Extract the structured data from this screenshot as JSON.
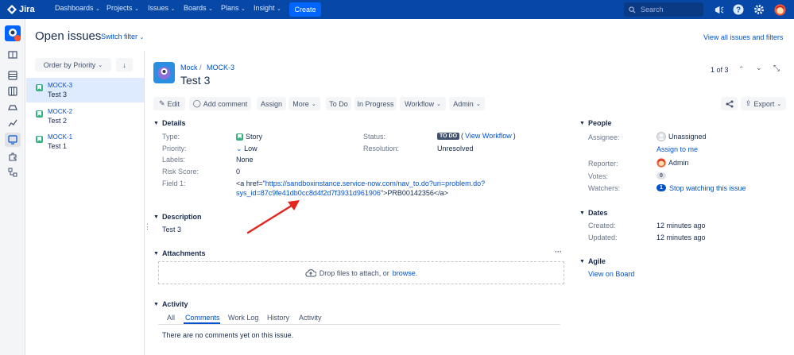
{
  "topnav": {
    "logo_text": "Jira",
    "items": [
      "Dashboards",
      "Projects",
      "Issues",
      "Boards",
      "Plans",
      "Insight"
    ],
    "create_label": "Create",
    "search_placeholder": "Search"
  },
  "page": {
    "title": "Open issues",
    "switch_filter": "Switch filter",
    "view_all": "View all issues and filters"
  },
  "list": {
    "order_by": "Order by Priority",
    "sort_arrow": "↓",
    "items": [
      {
        "key": "MOCK-3",
        "summary": "Test 3"
      },
      {
        "key": "MOCK-2",
        "summary": "Test 2"
      },
      {
        "key": "MOCK-1",
        "summary": "Test 1"
      }
    ]
  },
  "issue": {
    "breadcrumb_project": "Mock",
    "breadcrumb_sep": "/",
    "breadcrumb_key": "MOCK-3",
    "title": "Test 3",
    "pager": "1 of 3",
    "toolbar": {
      "edit": "Edit",
      "add_comment": "Add comment",
      "assign": "Assign",
      "more": "More",
      "to_do": "To Do",
      "in_progress": "In Progress",
      "workflow": "Workflow",
      "admin": "Admin",
      "export": "Export"
    },
    "details": {
      "heading": "Details",
      "type_label": "Type:",
      "type_value": "Story",
      "priority_label": "Priority:",
      "priority_value": "Low",
      "labels_label": "Labels:",
      "labels_value": "None",
      "risk_label": "Risk Score:",
      "risk_value": "0",
      "field1_label": "Field 1:",
      "field1_prefix": "<a href=\"",
      "field1_url_line1": "https://sandboxinstance.service-now.com/nav_to.do?uri=problem.do?",
      "field1_url_line2": "sys_id=87c9fe41db0cc8d4f2d7f3931d961906",
      "field1_suffix": "\">PRB00142356</a>",
      "status_label": "Status:",
      "status_badge": "TO DO",
      "status_open_paren": "(",
      "status_link": "View Workflow",
      "status_close_paren": ")",
      "resolution_label": "Resolution:",
      "resolution_value": "Unresolved"
    },
    "description": {
      "heading": "Description",
      "text": "Test 3"
    },
    "attachments": {
      "heading": "Attachments",
      "drop_text": "Drop files to attach, or",
      "browse": "browse.",
      "more": "···"
    },
    "activity": {
      "heading": "Activity",
      "tabs": [
        "All",
        "Comments",
        "Work Log",
        "History",
        "Activity"
      ],
      "active_tab": "Comments",
      "empty": "There are no comments yet on this issue."
    }
  },
  "people": {
    "heading": "People",
    "assignee_label": "Assignee:",
    "assignee_value": "Unassigned",
    "assign_to_me": "Assign to me",
    "reporter_label": "Reporter:",
    "reporter_value": "Admin",
    "votes_label": "Votes:",
    "votes_value": "0",
    "watchers_label": "Watchers:",
    "watchers_count": "1",
    "watchers_link": "Stop watching this issue"
  },
  "dates": {
    "heading": "Dates",
    "created_label": "Created:",
    "created_value": "12 minutes ago",
    "updated_label": "Updated:",
    "updated_value": "12 minutes ago"
  },
  "agile": {
    "heading": "Agile",
    "link": "View on Board"
  },
  "colors": {
    "nav": "#0747a6",
    "link": "#0052cc",
    "arrow": "#e5261f",
    "story": "#36b37e"
  }
}
